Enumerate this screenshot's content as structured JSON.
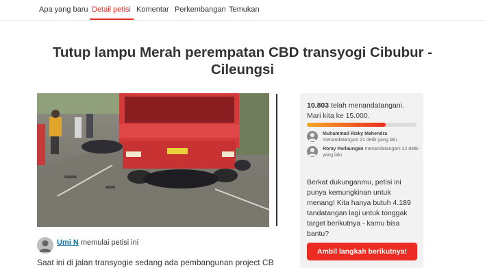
{
  "nav": {
    "tabs": [
      {
        "label": "Apa yang baru",
        "active": false
      },
      {
        "label": "Detail petisi",
        "active": true
      },
      {
        "label": "Komentar",
        "active": false
      },
      {
        "label": "Perkembangan",
        "active": false
      },
      {
        "label": "Temukan",
        "active": false
      }
    ]
  },
  "petition": {
    "title": "Tutup lampu Merah perempatan CBD transyogi Cibubur - Cileungsi",
    "starter_name": "Umi N",
    "starter_action": " memulai petisi ini",
    "teaser": "Saat ini di jalan transyogie sedang ada pembangunan project CBD"
  },
  "sidebar": {
    "signed_count": "10.803",
    "signed_suffix": " telah menandatangani.",
    "goal_text": "Mari kita ke 15.000.",
    "progress_fraction": 0.72,
    "recent_signers": [
      {
        "name": "Muhammad Rizky Mahendra",
        "meta": "menandatangani 21 detik yang lalu"
      },
      {
        "name": "Romy Parlaungan",
        "meta": "menandatangani 22 detik yang lalu"
      }
    ],
    "pitch": "Berkat dukunganmu, petisi ini punya kemungkinan untuk menang! Kita hanya butuh 4.189 tandatangan lagi untuk tonggak target berikutnya - kamu bisa bantu?",
    "cta_label": "Ambil langkah berikutnya!"
  },
  "colors": {
    "accent": "#ec2c22",
    "link": "#0d6fa8",
    "panel_bg": "#f2f2f2"
  }
}
